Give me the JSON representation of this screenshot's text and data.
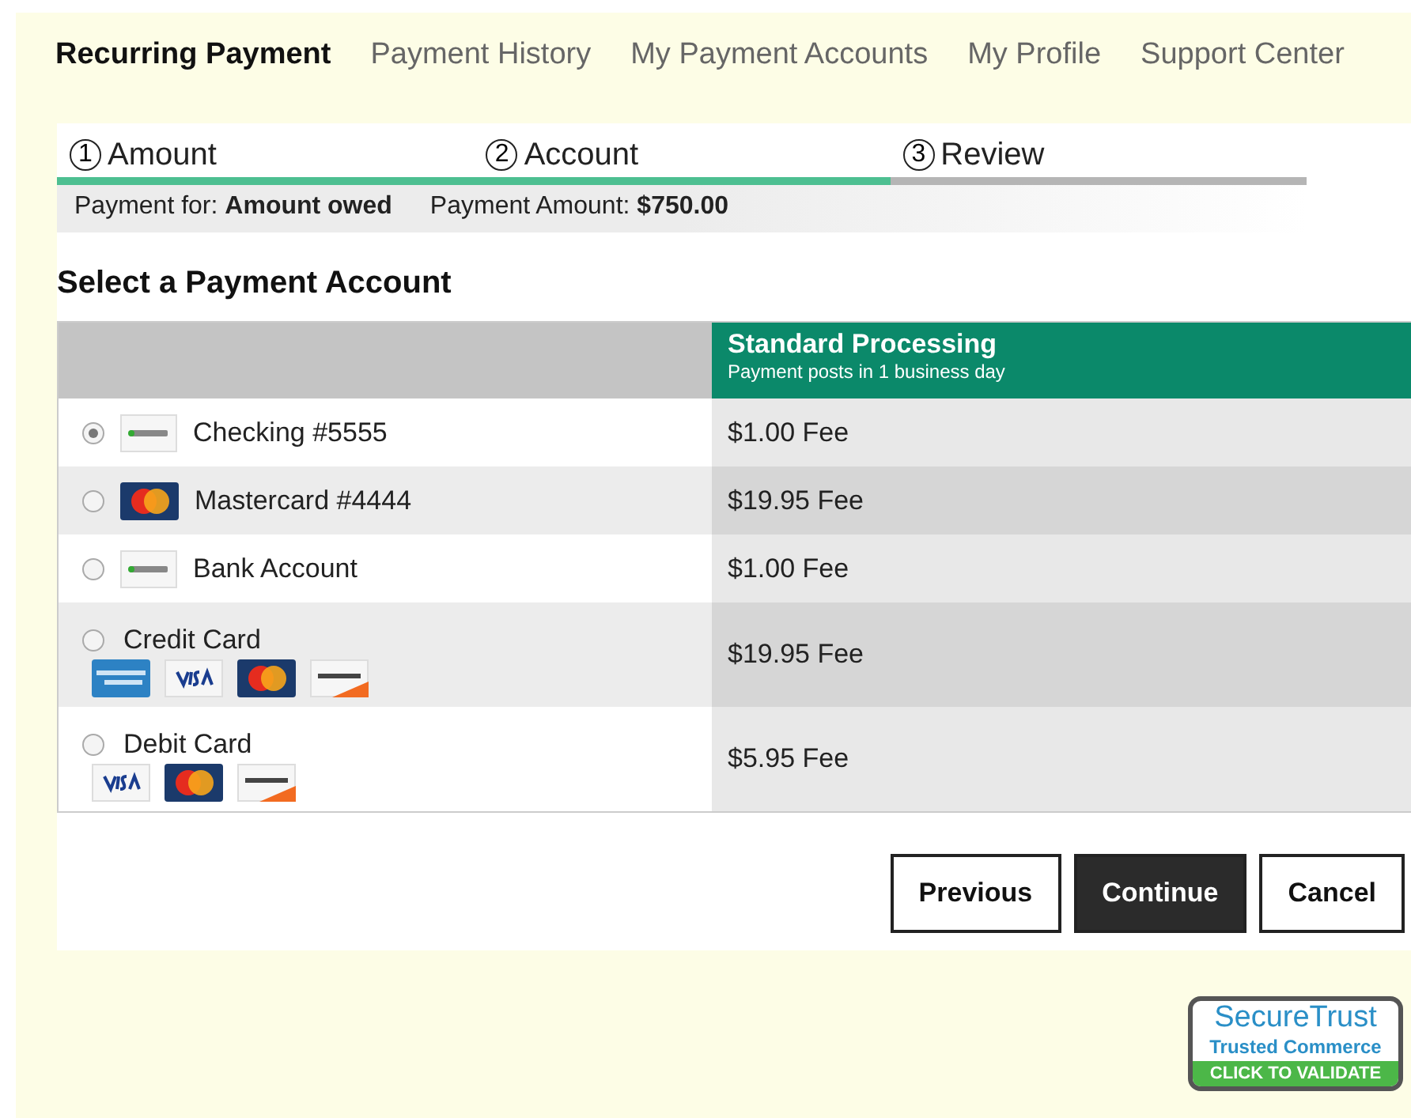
{
  "nav": [
    {
      "label": "Recurring Payment",
      "selected": true
    },
    {
      "label": "Payment History",
      "selected": false
    },
    {
      "label": "My Payment Accounts",
      "selected": false
    },
    {
      "label": "My Profile",
      "selected": false
    },
    {
      "label": "Support Center",
      "selected": false
    }
  ],
  "steps": [
    {
      "number": "1",
      "label": "Amount"
    },
    {
      "number": "2",
      "label": "Account"
    },
    {
      "number": "3",
      "label": "Review"
    }
  ],
  "progress": {
    "level": 0.667
  },
  "summary": [
    {
      "label": "Payment for:",
      "value": "Amount owed"
    },
    {
      "label": "Payment Amount:",
      "value": "$750.00"
    }
  ],
  "section_title": "Select a Payment Account",
  "table": {
    "header": {
      "title": "Standard Processing",
      "subtitle": "Payment posts in 1 business day"
    },
    "rows": [
      {
        "kind": "inline",
        "label": "Checking #5555",
        "logos": [
          {
            "kind": "echeck"
          }
        ],
        "fee": "$1.00 Fee",
        "selected": true
      },
      {
        "kind": "inline",
        "label": "Mastercard #4444",
        "logos": [
          {
            "kind": "mastercard"
          }
        ],
        "fee": "$19.95 Fee",
        "selected": false
      },
      {
        "kind": "inline",
        "label": "Bank Account",
        "logos": [
          {
            "kind": "echeck"
          }
        ],
        "fee": "$1.00 Fee",
        "selected": false
      },
      {
        "kind": "stacked",
        "label": "Credit Card",
        "logos": [
          {
            "kind": "amex"
          },
          {
            "kind": "visa"
          },
          {
            "kind": "mastercard"
          },
          {
            "kind": "discover"
          }
        ],
        "fee": "$19.95 Fee",
        "selected": false
      },
      {
        "kind": "stacked",
        "label": "Debit Card",
        "logos": [
          {
            "kind": "visa"
          },
          {
            "kind": "mastercard"
          },
          {
            "kind": "discover"
          }
        ],
        "fee": "$5.95 Fee",
        "selected": false
      }
    ]
  },
  "buttons": [
    {
      "label": "Previous",
      "kind": "secondary"
    },
    {
      "label": "Continue",
      "kind": "primary"
    },
    {
      "label": "Cancel",
      "kind": "secondary"
    }
  ],
  "seal": {
    "title": "SecureTrust",
    "subtitle": "Trusted Commerce",
    "action": "CLICK TO VALIDATE"
  }
}
